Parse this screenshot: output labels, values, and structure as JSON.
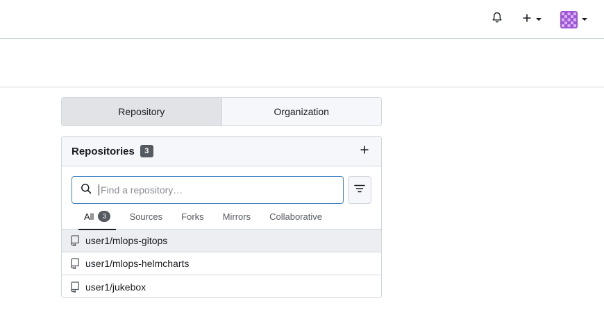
{
  "navbar": {
    "icons": [
      "bell-icon",
      "plus-icon",
      "avatar"
    ],
    "avatar_color": "#9e55d6"
  },
  "switch": {
    "items": [
      {
        "label": "Repository",
        "active": true
      },
      {
        "label": "Organization",
        "active": false
      }
    ]
  },
  "repos_panel": {
    "title": "Repositories",
    "count": "3",
    "search": {
      "placeholder": "Find a repository…",
      "value": ""
    },
    "tabs": [
      {
        "label": "All",
        "badge": "3",
        "active": true
      },
      {
        "label": "Sources"
      },
      {
        "label": "Forks"
      },
      {
        "label": "Mirrors"
      },
      {
        "label": "Collaborative"
      }
    ],
    "repos": [
      {
        "name": "user1/mlops-gitops"
      },
      {
        "name": "user1/mlops-helmcharts"
      },
      {
        "name": "user1/jukebox"
      }
    ]
  },
  "colors": {
    "border": "#d0d7de",
    "focus": "#4183c4",
    "badge": "#555a61"
  }
}
